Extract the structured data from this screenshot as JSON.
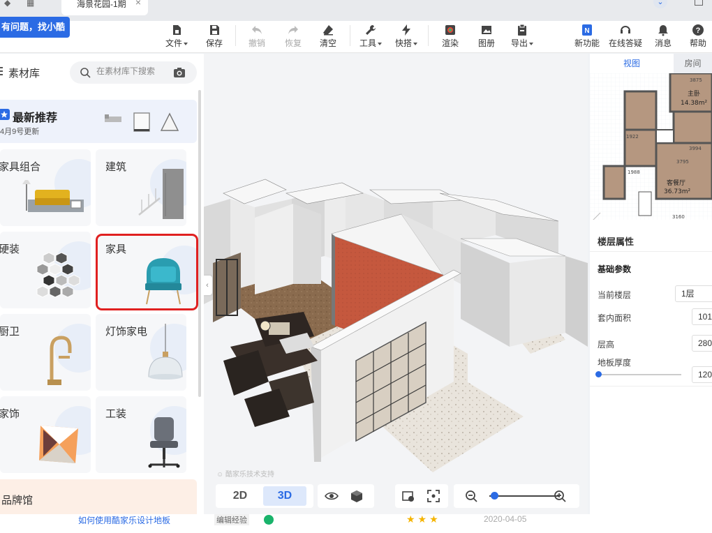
{
  "browser": {
    "tab_title": "海景花园-1期",
    "tab_close": "×"
  },
  "help_banner": "有问题，找小酷",
  "toolbar": {
    "file": "文件",
    "save": "保存",
    "undo": "撤销",
    "redo": "恢复",
    "clear": "清空",
    "tools": "工具",
    "shortcut": "快搭",
    "render": "渲染",
    "album": "图册",
    "export": "导出",
    "new_feature": "新功能",
    "online_help": "在线答疑",
    "messages": "消息",
    "help": "帮助"
  },
  "library": {
    "title": "素材库",
    "search_placeholder": "在素材库下搜索",
    "recommend": {
      "title": "最新推荐",
      "date": "4月9号更新"
    },
    "categories": [
      {
        "label": "家具组合"
      },
      {
        "label": "建筑"
      },
      {
        "label": "硬装"
      },
      {
        "label": "家具"
      },
      {
        "label": "厨卫"
      },
      {
        "label": "灯饰家电"
      },
      {
        "label": "家饰"
      },
      {
        "label": "工装"
      }
    ],
    "brand": "品牌馆"
  },
  "viewport": {
    "watermark": "酷家乐技术支持",
    "mode_2d": "2D",
    "mode_3d": "3D",
    "active_mode": "3D"
  },
  "right_panel": {
    "tabs": {
      "view": "视图",
      "room": "房间"
    },
    "minimap": {
      "room1_name": "主卧",
      "room1_area": "14.38m²",
      "room2_name": "客餐厅",
      "room2_area": "36.73m²",
      "dims": [
        "3875",
        "1922",
        "3994",
        "1988",
        "3795",
        "3160"
      ]
    },
    "floor_props": {
      "title": "楼层属性",
      "section": "基础参数",
      "current_floor_label": "当前楼层",
      "current_floor_value": "1层",
      "area_label": "套内面积",
      "area_value": "101",
      "height_label": "层高",
      "height_value": "280",
      "thickness_label": "地板厚度",
      "thickness_value": "120"
    }
  },
  "bottom": {
    "link_text": "如何使用酷家乐设计地板",
    "tag": "编辑经验",
    "stars": "★★★",
    "date": "2020-04-05"
  },
  "colors": {
    "accent": "#2b6be4",
    "highlight": "#e02020"
  }
}
